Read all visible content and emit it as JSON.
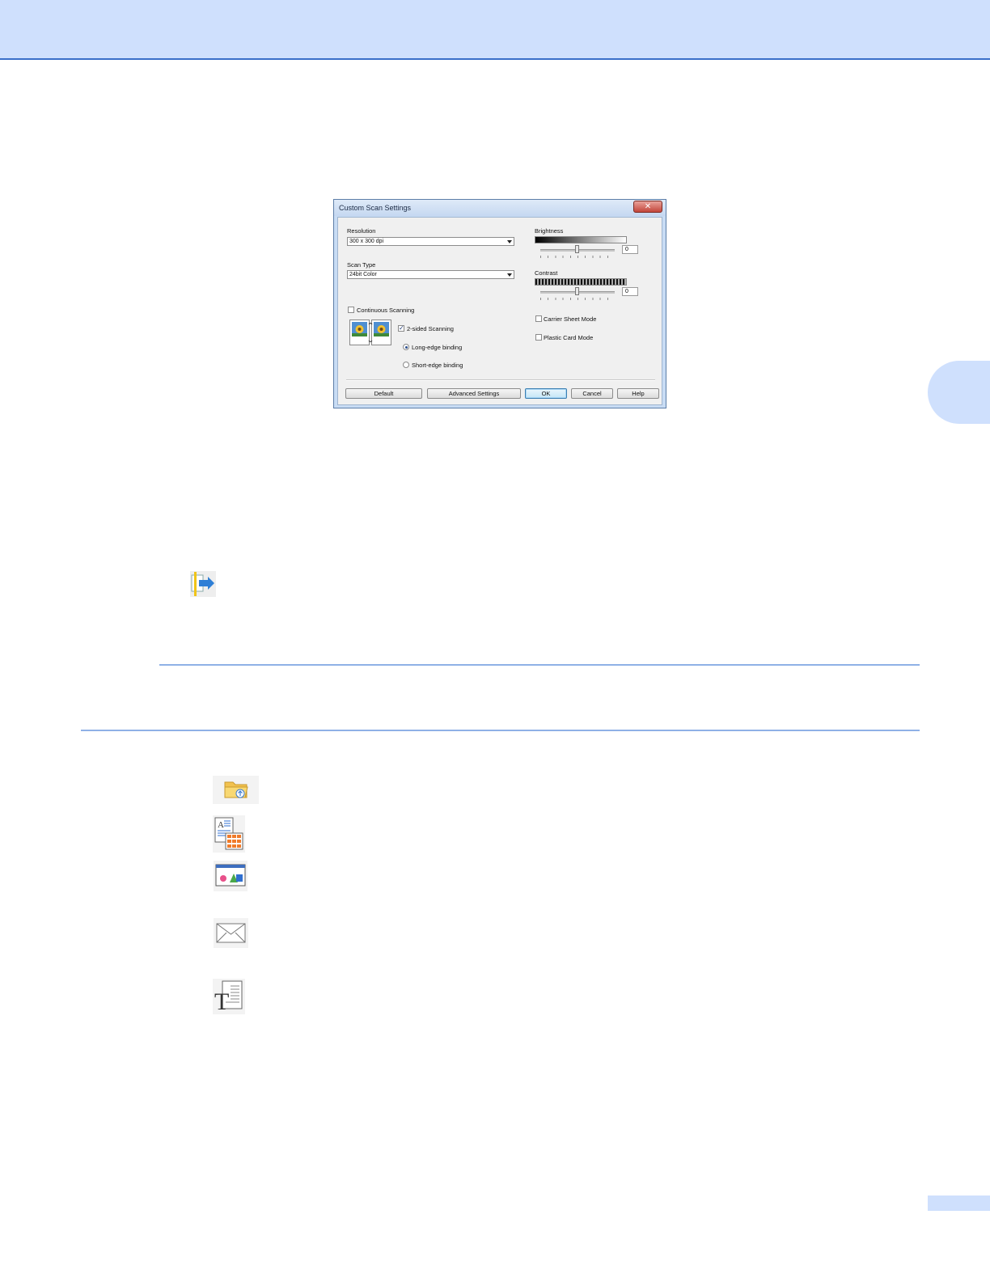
{
  "dialog": {
    "title": "Custom Scan Settings",
    "close_glyph": "✕",
    "resolution": {
      "label": "Resolution",
      "value": "300 x 300 dpi"
    },
    "scan_type": {
      "label": "Scan Type",
      "value": "24bit Color"
    },
    "continuous_scanning": {
      "label": "Continuous Scanning",
      "checked": false
    },
    "two_sided_scanning": {
      "label": "2-sided Scanning",
      "checked": true,
      "check_glyph": "✓"
    },
    "binding": {
      "long_edge": {
        "label": "Long-edge binding",
        "selected": true
      },
      "short_edge": {
        "label": "Short-edge binding",
        "selected": false
      }
    },
    "brightness": {
      "label": "Brightness",
      "value": "0"
    },
    "contrast": {
      "label": "Contrast",
      "value": "0"
    },
    "carrier_sheet_mode": {
      "label": "Carrier Sheet Mode",
      "checked": false
    },
    "plastic_card_mode": {
      "label": "Plastic Card Mode",
      "checked": false
    },
    "buttons": {
      "default": "Default",
      "advanced": "Advanced Settings",
      "ok": "OK",
      "cancel": "Cancel",
      "help": "Help"
    }
  },
  "icons": [
    "scan-to-pc-icon",
    "folder-upload-icon",
    "document-table-icon",
    "image-shapes-icon",
    "envelope-email-icon",
    "text-ocr-icon"
  ],
  "colors": {
    "header_band": "#cfe0fd",
    "header_border": "#3a6fc9",
    "rule": "#8fb1e6"
  }
}
